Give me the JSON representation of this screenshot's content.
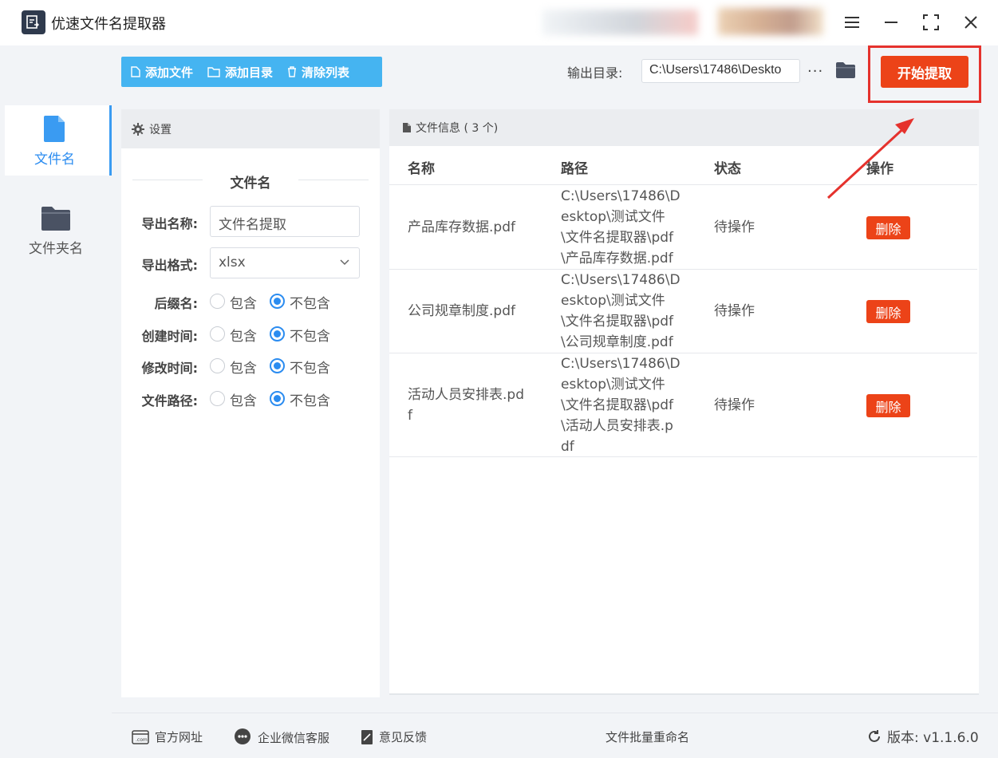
{
  "app": {
    "title": "优速文件名提取器"
  },
  "nav": {
    "items": [
      {
        "label": "文件名",
        "icon": "file-icon",
        "active": true
      },
      {
        "label": "文件夹名",
        "icon": "folder-icon",
        "active": false
      }
    ]
  },
  "toolbar": {
    "add_file": "添加文件",
    "add_dir": "添加目录",
    "clear_list": "清除列表",
    "output_label": "输出目录:",
    "output_path": "C:\\Users\\17486\\Deskto",
    "more": "···",
    "start": "开始提取"
  },
  "settings": {
    "header": "设置",
    "section_title": "文件名",
    "export_name_label": "导出名称:",
    "export_name_value": "文件名提取",
    "export_format_label": "导出格式:",
    "export_format_value": "xlsx",
    "options": [
      {
        "label": "后缀名:",
        "include": "包含",
        "exclude": "不包含",
        "selected": "exclude"
      },
      {
        "label": "创建时间:",
        "include": "包含",
        "exclude": "不包含",
        "selected": "exclude"
      },
      {
        "label": "修改时间:",
        "include": "包含",
        "exclude": "不包含",
        "selected": "exclude"
      },
      {
        "label": "文件路径:",
        "include": "包含",
        "exclude": "不包含",
        "selected": "exclude"
      }
    ]
  },
  "fileinfo": {
    "header": "文件信息 ( 3 个)",
    "columns": [
      "名称",
      "路径",
      "状态",
      "操作"
    ],
    "rows": [
      {
        "name": "产品库存数据.pdf",
        "path": "C:\\Users\\17486\\Desktop\\测试文件\\文件名提取器\\pdf\\产品库存数据.pdf",
        "status": "待操作",
        "action": "删除"
      },
      {
        "name": "公司规章制度.pdf",
        "path": "C:\\Users\\17486\\Desktop\\测试文件\\文件名提取器\\pdf\\公司规章制度.pdf",
        "status": "待操作",
        "action": "删除"
      },
      {
        "name": "活动人员安排表.pdf",
        "path": "C:\\Users\\17486\\Desktop\\测试文件\\文件名提取器\\pdf\\活动人员安排表.pdf",
        "status": "待操作",
        "action": "删除"
      }
    ]
  },
  "statusbar": {
    "website": "官方网址",
    "wechat": "企业微信客服",
    "feedback": "意见反馈",
    "rename": "文件批量重命名",
    "version": "版本: v1.1.6.0"
  },
  "colors": {
    "accent_blue": "#2b8cf0",
    "toolbar_blue": "#45b4f1",
    "action_red": "#ec4318",
    "annotation_red": "#e5322d"
  }
}
